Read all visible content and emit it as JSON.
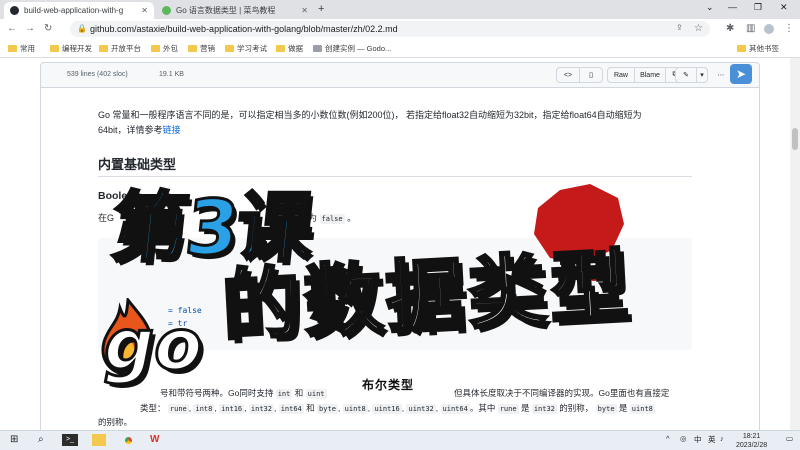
{
  "browser": {
    "tabs": [
      {
        "title": "build-web-application-with-g",
        "active": true
      },
      {
        "title": "Go 语言数据类型 | 菜鸟教程",
        "active": false
      }
    ],
    "new_tab": "+",
    "url": "github.com/astaxie/build-web-application-with-golang/blob/master/zh/02.2.md",
    "bookmarks": [
      "常用",
      "编程开发",
      "开放平台",
      "外包",
      "营销",
      "学习考试",
      "做据",
      "创建实例 — Godo...",
      "其他书签"
    ]
  },
  "file": {
    "lines": "539 lines (402 sloc)",
    "size": "19.1 KB",
    "raw": "Raw",
    "blame": "Blame"
  },
  "article": {
    "intro_line1": "Go 常量和一般程序语言不同的是，可以指定相当多的小数位数(例如200位)，  若指定给float32自动缩短为32bit，指定给float64自动缩短为",
    "intro_line2": "64bit，详情参考",
    "intro_link": "链接",
    "h2": "内置基础类型",
    "h3": "Boolean",
    "bool_prefix": "在G",
    "bool_tail": "认为",
    "bool_false": "false",
    "bool_end": "。",
    "code_frag1": "= false",
    "code_frag2": "= tr",
    "int_line1": "号和带符号两种。Go同时支持",
    "int_code1": "int",
    "int_and": "和",
    "int_code2": "uint",
    "int_line1_tail": "但具体长度取决于不同编译器的实现。Go里面也有直接定",
    "int_line2_prefix": "类型：",
    "types": [
      "rune",
      "int8",
      "int16",
      "int32",
      "int64"
    ],
    "and_word": "和",
    "types2": [
      "byte",
      "uint8",
      "uint16",
      "uint32",
      "uint64"
    ],
    "alias_text1": "。其中",
    "alias_rune": "rune",
    "alias_is": "是",
    "alias_int32": "int32",
    "alias_text2": "的别称，",
    "alias_byte": "byte",
    "alias_is2": "是",
    "alias_uint8": "uint8",
    "int_line3": "的别称。"
  },
  "overlay": {
    "lesson": "第3课",
    "topic": "的数据类型",
    "go": "go",
    "subtitle": "布尔类型",
    "accent_blue": "#2aa1e6",
    "accent_red": "#c41a1a"
  },
  "taskbar": {
    "time": "18:21",
    "date": "2023/2/28",
    "tray_lang": "中",
    "tray_input": "英"
  }
}
